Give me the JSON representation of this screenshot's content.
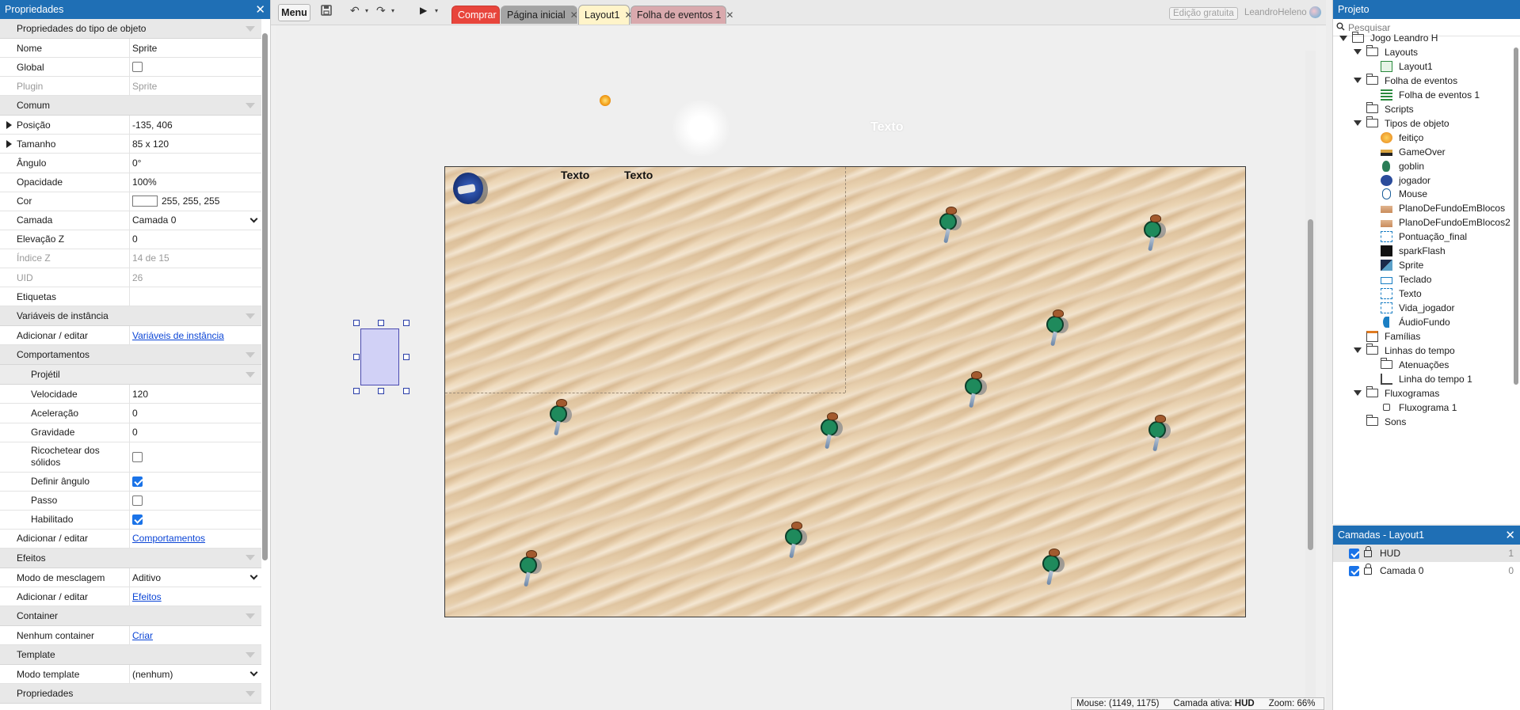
{
  "properties_panel": {
    "title": "Propriedades",
    "sections": {
      "object_type": "Propriedades do tipo de objeto",
      "common": "Comum",
      "instance_vars": "Variáveis de instância",
      "behaviors": "Comportamentos",
      "projectile": "Projétil",
      "effects": "Efeitos",
      "container": "Container",
      "template": "Template",
      "properties": "Propriedades"
    },
    "rows": {
      "name": {
        "key": "Nome",
        "value": "Sprite"
      },
      "global": {
        "key": "Global",
        "checked": false
      },
      "plugin": {
        "key": "Plugin",
        "value": "Sprite"
      },
      "position": {
        "key": "Posição",
        "value": "-135, 406"
      },
      "size": {
        "key": "Tamanho",
        "value": "85 x 120"
      },
      "angle": {
        "key": "Ângulo",
        "value": "0°"
      },
      "opacity": {
        "key": "Opacidade",
        "value": "100%"
      },
      "color": {
        "key": "Cor",
        "value": "255, 255, 255",
        "swatch": "#ffffff"
      },
      "layer": {
        "key": "Camada",
        "value": "Camada 0"
      },
      "z_elevation": {
        "key": "Elevação Z",
        "value": "0"
      },
      "z_index": {
        "key": "Índice Z",
        "value": "14 de 15"
      },
      "uid": {
        "key": "UID",
        "value": "26"
      },
      "tags": {
        "key": "Etiquetas",
        "value": ""
      },
      "instance_vars_edit": {
        "key": "Adicionar / editar",
        "link": "Variáveis de instância"
      },
      "speed": {
        "key": "Velocidade",
        "value": "120"
      },
      "acceleration": {
        "key": "Aceleração",
        "value": "0"
      },
      "gravity": {
        "key": "Gravidade",
        "value": "0"
      },
      "bounce": {
        "key": "Ricochetear dos sólidos",
        "checked": false
      },
      "set_angle": {
        "key": "Definir ângulo",
        "checked": true
      },
      "step": {
        "key": "Passo",
        "checked": false
      },
      "enabled": {
        "key": "Habilitado",
        "checked": true
      },
      "behaviors_edit": {
        "key": "Adicionar / editar",
        "link": "Comportamentos"
      },
      "blend_mode": {
        "key": "Modo de mesclagem",
        "value": "Aditivo"
      },
      "effects_edit": {
        "key": "Adicionar / editar",
        "link": "Efeitos"
      },
      "container": {
        "key": "Nenhum container",
        "link": "Criar"
      },
      "template_mode": {
        "key": "Modo template",
        "value": "(nenhum)"
      }
    }
  },
  "toolbar": {
    "menu_label": "Menu",
    "save_icon": "save-icon",
    "undo_icon": "undo-icon",
    "redo_icon": "redo-icon",
    "play_icon": "play-icon"
  },
  "tabs": [
    {
      "label": "Comprar",
      "color": "#e8453c"
    },
    {
      "label": "Página inicial",
      "color": "#9e9e9e"
    },
    {
      "label": "Layout1",
      "color": "#fff4c9"
    },
    {
      "label": "Folha de eventos 1",
      "color": "#d9a9ad"
    }
  ],
  "header_right": {
    "edition": "Edição gratuita",
    "user": "LeandroHeleno"
  },
  "canvas": {
    "texts": [
      "Texto",
      "Texto",
      "Texto"
    ]
  },
  "statusbar": {
    "mouse": "Mouse: (1149, 1175)",
    "active_layer_label": "Camada ativa:",
    "active_layer": "HUD",
    "zoom": "Zoom: 66%"
  },
  "project_panel": {
    "title": "Projeto",
    "search_placeholder": "Pesquisar",
    "nodes": [
      {
        "label": "Jogo Leandro H",
        "icon": "folder-icon"
      },
      {
        "label": "Layouts",
        "icon": "folder-icon"
      },
      {
        "label": "Layout1",
        "icon": "layout-icon"
      },
      {
        "label": "Folha de eventos",
        "icon": "folder-icon"
      },
      {
        "label": "Folha de eventos 1",
        "icon": "event-sheet-icon"
      },
      {
        "label": "Scripts",
        "icon": "folder-icon"
      },
      {
        "label": "Tipos de objeto",
        "icon": "folder-icon"
      },
      {
        "label": "feitiço",
        "icon": "fireball-icon"
      },
      {
        "label": "GameOver",
        "icon": "gameover-icon"
      },
      {
        "label": "goblin",
        "icon": "goblin-icon"
      },
      {
        "label": "jogador",
        "icon": "player-icon"
      },
      {
        "label": "Mouse",
        "icon": "mouse-icon"
      },
      {
        "label": "PlanoDeFundoEmBlocos",
        "icon": "tiledbg-icon"
      },
      {
        "label": "PlanoDeFundoEmBlocos2",
        "icon": "tiledbg-icon"
      },
      {
        "label": "Pontuação_final",
        "icon": "text-icon"
      },
      {
        "label": "sparkFlash",
        "icon": "spark-icon"
      },
      {
        "label": "Sprite",
        "icon": "sprite-icon"
      },
      {
        "label": "Teclado",
        "icon": "keyboard-icon"
      },
      {
        "label": "Texto",
        "icon": "text-icon"
      },
      {
        "label": "Vida_jogador",
        "icon": "text-icon"
      },
      {
        "label": "ÁudioFundo",
        "icon": "audio-icon"
      },
      {
        "label": "Famílias",
        "icon": "families-icon"
      },
      {
        "label": "Linhas do tempo",
        "icon": "folder-icon"
      },
      {
        "label": "Atenuações",
        "icon": "folder-icon"
      },
      {
        "label": "Linha do tempo 1",
        "icon": "timeline-icon"
      },
      {
        "label": "Fluxogramas",
        "icon": "folder-icon"
      },
      {
        "label": "Fluxograma 1",
        "icon": "flowchart-icon"
      },
      {
        "label": "Sons",
        "icon": "folder-icon"
      }
    ]
  },
  "layers_panel": {
    "title": "Camadas - Layout1",
    "layers": [
      {
        "name": "HUD",
        "index": "1",
        "visible": true
      },
      {
        "name": "Camada 0",
        "index": "0",
        "visible": true
      }
    ]
  }
}
